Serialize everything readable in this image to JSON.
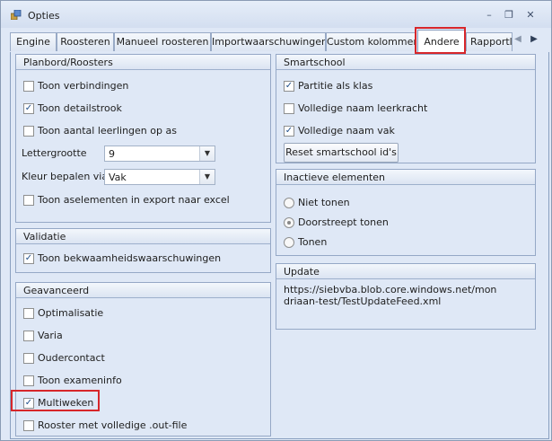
{
  "window": {
    "title": "Opties",
    "minimize": "–",
    "restore": "❐",
    "close": "✕"
  },
  "tabs": [
    "Engine",
    "Roosteren",
    "Manueel roosteren",
    "Importwaarschuwingen",
    "Custom kolommen",
    "Andere",
    "Rapportlay"
  ],
  "active_tab": "Andere",
  "tab_scroll": {
    "left": "◀",
    "right": "▶"
  },
  "planbord": {
    "title": "Planbord/Roosters",
    "toon_verbindingen": {
      "label": "Toon verbindingen",
      "checked": false
    },
    "toon_detailstrook": {
      "label": "Toon detailstrook",
      "checked": true
    },
    "toon_aantal": {
      "label": "Toon aantal leerlingen op as",
      "checked": false
    },
    "lettergrootte_label": "Lettergrootte",
    "lettergrootte_value": "9",
    "kleur_label": "Kleur bepalen via",
    "kleur_value": "Vak",
    "toon_aselementen": {
      "label": "Toon aselementen in export naar excel",
      "checked": false
    }
  },
  "validatie": {
    "title": "Validatie",
    "toon_bekwaamheid": {
      "label": "Toon bekwaamheidswaarschuwingen",
      "checked": true
    }
  },
  "geavanceerd": {
    "title": "Geavanceerd",
    "optimalisatie": {
      "label": "Optimalisatie",
      "checked": false
    },
    "varia": {
      "label": "Varia",
      "checked": false
    },
    "oudercontact": {
      "label": "Oudercontact",
      "checked": false
    },
    "examen": {
      "label": "Toon exameninfo",
      "checked": false
    },
    "multiweken": {
      "label": "Multiweken",
      "checked": true
    },
    "rooster_out": {
      "label": "Rooster met volledige .out-file",
      "checked": false
    }
  },
  "smartschool": {
    "title": "Smartschool",
    "partitie": {
      "label": "Partitie als klas",
      "checked": true
    },
    "naam_leerkracht": {
      "label": "Volledige naam leerkracht",
      "checked": false
    },
    "naam_vak": {
      "label": "Volledige naam vak",
      "checked": true
    },
    "reset_button": "Reset smartschool id's"
  },
  "inactieve": {
    "title": "Inactieve elementen",
    "niet_tonen": "Niet tonen",
    "doorstreept": "Doorstreept tonen",
    "tonen": "Tonen",
    "selected": "Doorstreept tonen"
  },
  "update": {
    "title": "Update",
    "url": "https://siebvba.blob.core.windows.net/mondriaan-test/TestUpdateFeed.xml"
  },
  "icons": {
    "check": "✓",
    "dropdown": "▼"
  },
  "colors": {
    "highlight": "#d7262a",
    "panel": "#dfe8f6",
    "border": "#95a8c6"
  }
}
